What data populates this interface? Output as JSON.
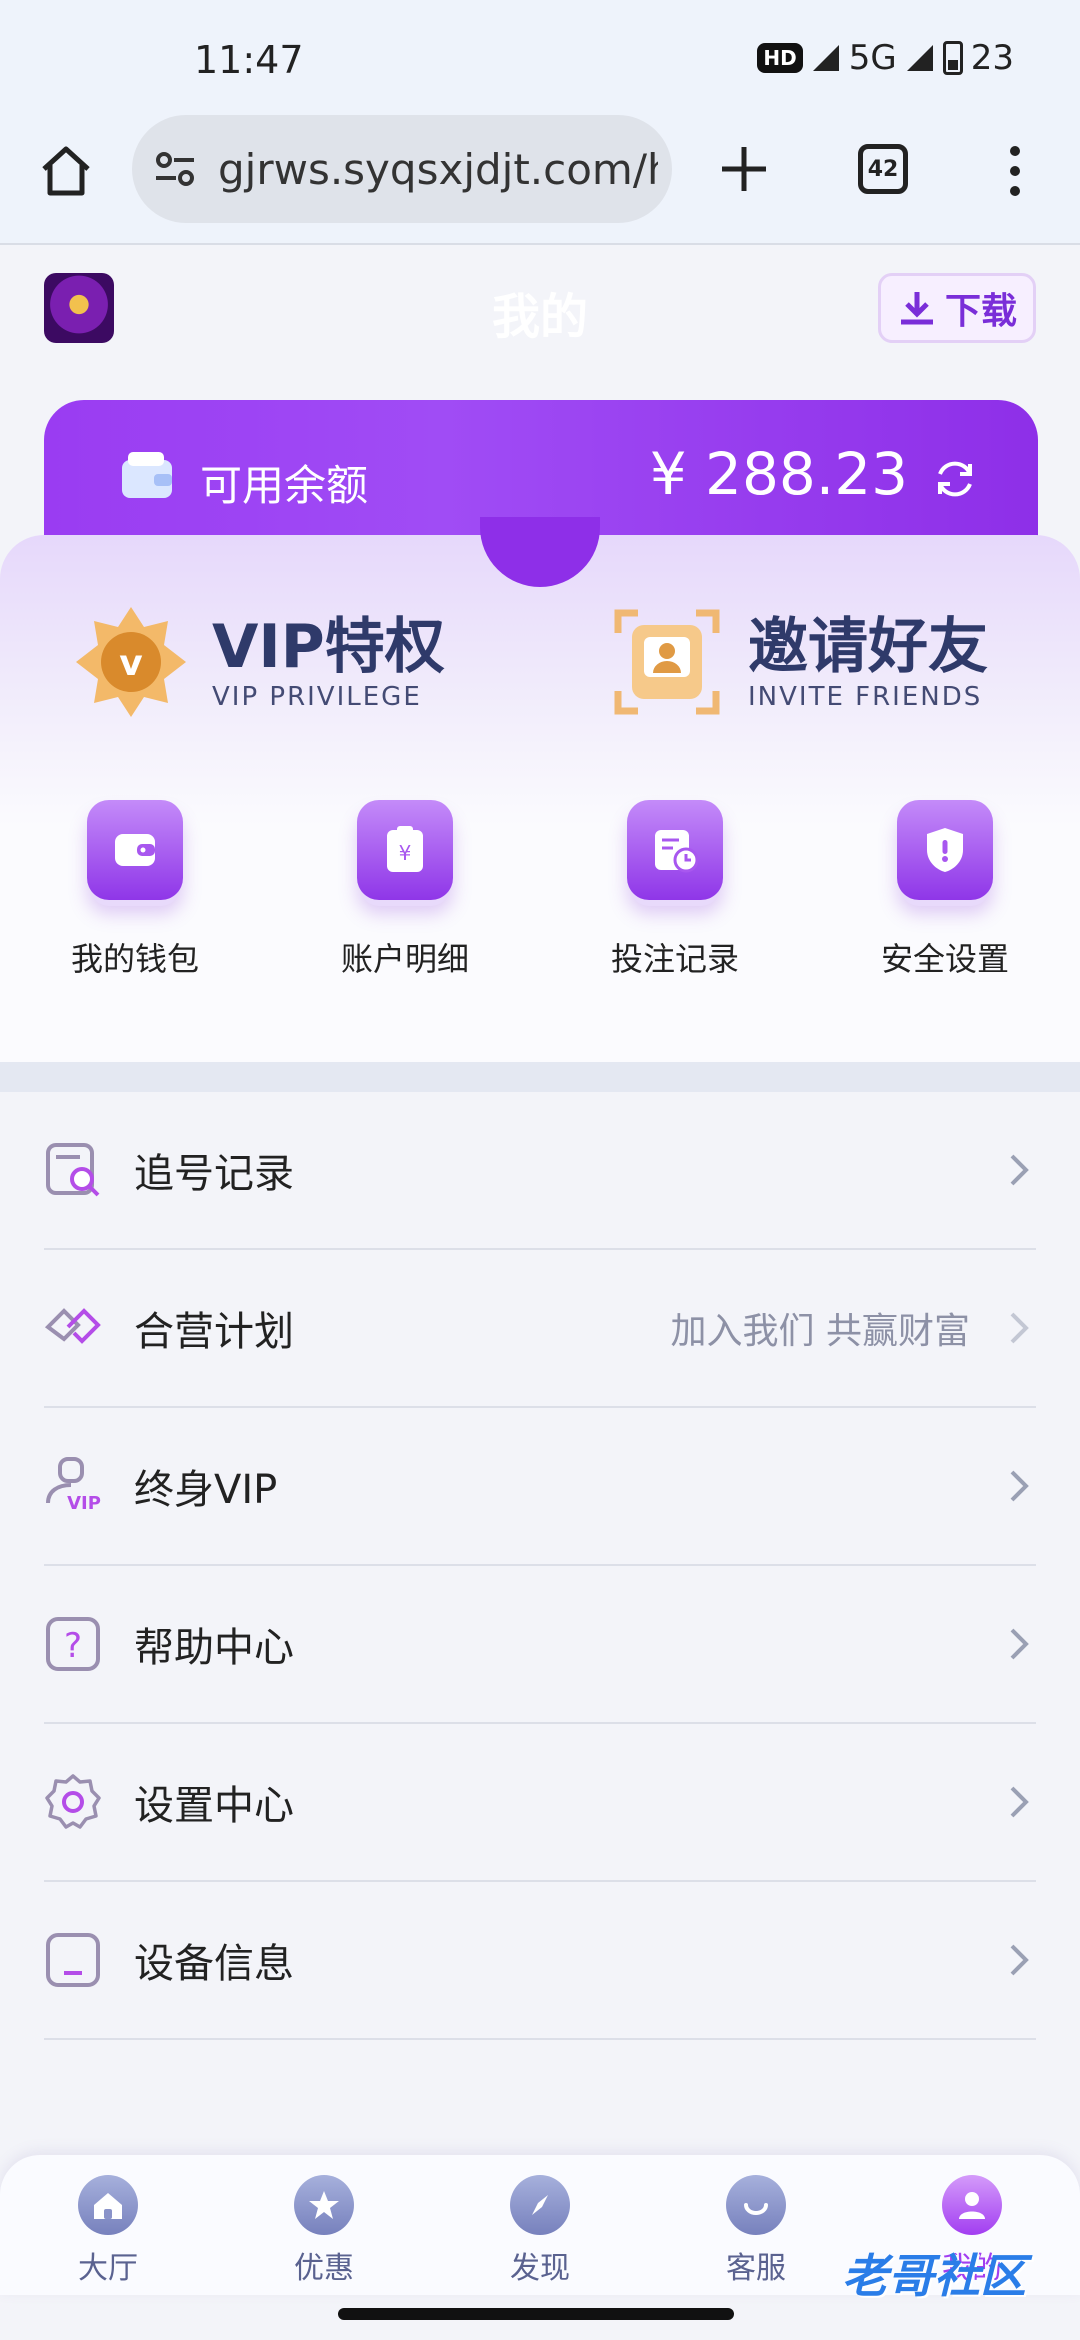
{
  "status_bar": {
    "time": "11:47",
    "hd": "HD",
    "network": "5G",
    "battery": "23"
  },
  "browser": {
    "url": "gjrws.syqsxjdjt.com/h",
    "tab_count": "42"
  },
  "header": {
    "title": "我的",
    "download_label": "下载"
  },
  "balance": {
    "label": "可用余额",
    "amount": "¥ 288.23"
  },
  "promos": [
    {
      "title": "VIP特权",
      "subtitle": "VIP PRIVILEGE"
    },
    {
      "title": "邀请好友",
      "subtitle": "INVITE FRIENDS"
    }
  ],
  "quick_actions": [
    {
      "label": "我的钱包",
      "icon": "wallet-icon"
    },
    {
      "label": "账户明细",
      "icon": "receipt-icon"
    },
    {
      "label": "投注记录",
      "icon": "record-icon"
    },
    {
      "label": "安全设置",
      "icon": "shield-icon"
    }
  ],
  "menu": [
    {
      "label": "追号记录",
      "hint": "",
      "icon": "search-record-icon"
    },
    {
      "label": "合营计划",
      "hint": "加入我们 共赢财富",
      "icon": "handshake-icon"
    },
    {
      "label": "终身VIP",
      "hint": "",
      "icon": "vip-user-icon"
    },
    {
      "label": "帮助中心",
      "hint": "",
      "icon": "help-icon"
    },
    {
      "label": "设置中心",
      "hint": "",
      "icon": "gear-icon"
    },
    {
      "label": "设备信息",
      "hint": "",
      "icon": "device-icon"
    }
  ],
  "bottom_nav": [
    {
      "label": "大厅",
      "icon": "home-icon",
      "active": false
    },
    {
      "label": "优惠",
      "icon": "star-icon",
      "active": false
    },
    {
      "label": "发现",
      "icon": "compass-icon",
      "active": false
    },
    {
      "label": "客服",
      "icon": "chat-icon",
      "active": false
    },
    {
      "label": "我的",
      "icon": "user-icon",
      "active": true
    }
  ],
  "watermark": "老哥社区",
  "colors": {
    "accent": "#9a3cf2",
    "nav_active": "#a23ef1",
    "nav_inactive": "#5a6290"
  }
}
